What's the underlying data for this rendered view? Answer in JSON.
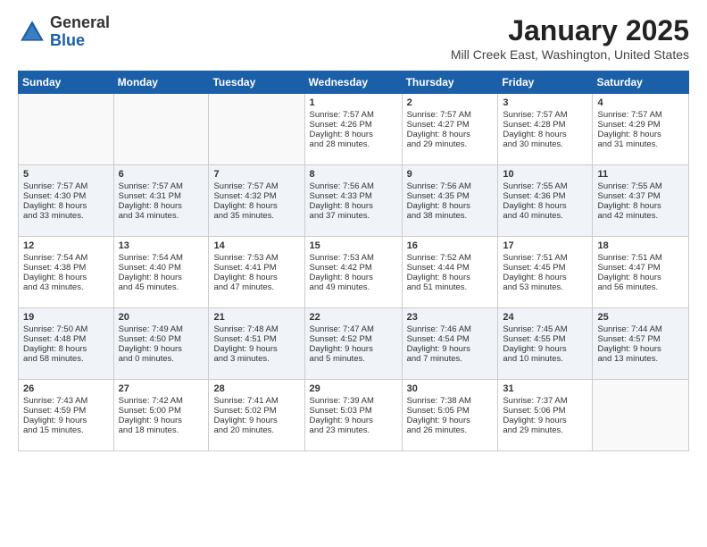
{
  "logo": {
    "general": "General",
    "blue": "Blue"
  },
  "header": {
    "title": "January 2025",
    "location": "Mill Creek East, Washington, United States"
  },
  "weekdays": [
    "Sunday",
    "Monday",
    "Tuesday",
    "Wednesday",
    "Thursday",
    "Friday",
    "Saturday"
  ],
  "weeks": [
    [
      {
        "day": "",
        "info": ""
      },
      {
        "day": "",
        "info": ""
      },
      {
        "day": "",
        "info": ""
      },
      {
        "day": "1",
        "info": "Sunrise: 7:57 AM\nSunset: 4:26 PM\nDaylight: 8 hours\nand 28 minutes."
      },
      {
        "day": "2",
        "info": "Sunrise: 7:57 AM\nSunset: 4:27 PM\nDaylight: 8 hours\nand 29 minutes."
      },
      {
        "day": "3",
        "info": "Sunrise: 7:57 AM\nSunset: 4:28 PM\nDaylight: 8 hours\nand 30 minutes."
      },
      {
        "day": "4",
        "info": "Sunrise: 7:57 AM\nSunset: 4:29 PM\nDaylight: 8 hours\nand 31 minutes."
      }
    ],
    [
      {
        "day": "5",
        "info": "Sunrise: 7:57 AM\nSunset: 4:30 PM\nDaylight: 8 hours\nand 33 minutes."
      },
      {
        "day": "6",
        "info": "Sunrise: 7:57 AM\nSunset: 4:31 PM\nDaylight: 8 hours\nand 34 minutes."
      },
      {
        "day": "7",
        "info": "Sunrise: 7:57 AM\nSunset: 4:32 PM\nDaylight: 8 hours\nand 35 minutes."
      },
      {
        "day": "8",
        "info": "Sunrise: 7:56 AM\nSunset: 4:33 PM\nDaylight: 8 hours\nand 37 minutes."
      },
      {
        "day": "9",
        "info": "Sunrise: 7:56 AM\nSunset: 4:35 PM\nDaylight: 8 hours\nand 38 minutes."
      },
      {
        "day": "10",
        "info": "Sunrise: 7:55 AM\nSunset: 4:36 PM\nDaylight: 8 hours\nand 40 minutes."
      },
      {
        "day": "11",
        "info": "Sunrise: 7:55 AM\nSunset: 4:37 PM\nDaylight: 8 hours\nand 42 minutes."
      }
    ],
    [
      {
        "day": "12",
        "info": "Sunrise: 7:54 AM\nSunset: 4:38 PM\nDaylight: 8 hours\nand 43 minutes."
      },
      {
        "day": "13",
        "info": "Sunrise: 7:54 AM\nSunset: 4:40 PM\nDaylight: 8 hours\nand 45 minutes."
      },
      {
        "day": "14",
        "info": "Sunrise: 7:53 AM\nSunset: 4:41 PM\nDaylight: 8 hours\nand 47 minutes."
      },
      {
        "day": "15",
        "info": "Sunrise: 7:53 AM\nSunset: 4:42 PM\nDaylight: 8 hours\nand 49 minutes."
      },
      {
        "day": "16",
        "info": "Sunrise: 7:52 AM\nSunset: 4:44 PM\nDaylight: 8 hours\nand 51 minutes."
      },
      {
        "day": "17",
        "info": "Sunrise: 7:51 AM\nSunset: 4:45 PM\nDaylight: 8 hours\nand 53 minutes."
      },
      {
        "day": "18",
        "info": "Sunrise: 7:51 AM\nSunset: 4:47 PM\nDaylight: 8 hours\nand 56 minutes."
      }
    ],
    [
      {
        "day": "19",
        "info": "Sunrise: 7:50 AM\nSunset: 4:48 PM\nDaylight: 8 hours\nand 58 minutes."
      },
      {
        "day": "20",
        "info": "Sunrise: 7:49 AM\nSunset: 4:50 PM\nDaylight: 9 hours\nand 0 minutes."
      },
      {
        "day": "21",
        "info": "Sunrise: 7:48 AM\nSunset: 4:51 PM\nDaylight: 9 hours\nand 3 minutes."
      },
      {
        "day": "22",
        "info": "Sunrise: 7:47 AM\nSunset: 4:52 PM\nDaylight: 9 hours\nand 5 minutes."
      },
      {
        "day": "23",
        "info": "Sunrise: 7:46 AM\nSunset: 4:54 PM\nDaylight: 9 hours\nand 7 minutes."
      },
      {
        "day": "24",
        "info": "Sunrise: 7:45 AM\nSunset: 4:55 PM\nDaylight: 9 hours\nand 10 minutes."
      },
      {
        "day": "25",
        "info": "Sunrise: 7:44 AM\nSunset: 4:57 PM\nDaylight: 9 hours\nand 13 minutes."
      }
    ],
    [
      {
        "day": "26",
        "info": "Sunrise: 7:43 AM\nSunset: 4:59 PM\nDaylight: 9 hours\nand 15 minutes."
      },
      {
        "day": "27",
        "info": "Sunrise: 7:42 AM\nSunset: 5:00 PM\nDaylight: 9 hours\nand 18 minutes."
      },
      {
        "day": "28",
        "info": "Sunrise: 7:41 AM\nSunset: 5:02 PM\nDaylight: 9 hours\nand 20 minutes."
      },
      {
        "day": "29",
        "info": "Sunrise: 7:39 AM\nSunset: 5:03 PM\nDaylight: 9 hours\nand 23 minutes."
      },
      {
        "day": "30",
        "info": "Sunrise: 7:38 AM\nSunset: 5:05 PM\nDaylight: 9 hours\nand 26 minutes."
      },
      {
        "day": "31",
        "info": "Sunrise: 7:37 AM\nSunset: 5:06 PM\nDaylight: 9 hours\nand 29 minutes."
      },
      {
        "day": "",
        "info": ""
      }
    ]
  ]
}
